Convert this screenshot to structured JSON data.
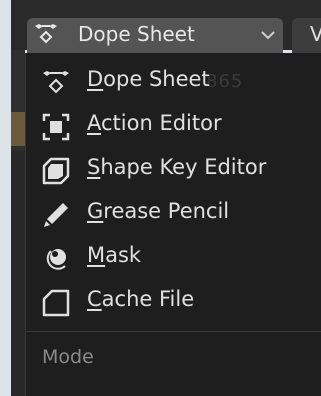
{
  "header": {
    "editor_type": {
      "label": "Dope Sheet",
      "icon": "dope-sheet-icon",
      "dropdown_icon": "chevron-down-icon"
    },
    "next_tab_initial": "V"
  },
  "background_ghost_text": "865",
  "menu": {
    "items": [
      {
        "accel": "D",
        "rest": "ope Sheet",
        "icon": "dope-sheet-icon"
      },
      {
        "accel": "A",
        "rest": "ction Editor",
        "icon": "action-editor-icon"
      },
      {
        "accel": "S",
        "rest": "hape Key Editor",
        "icon": "shape-key-icon"
      },
      {
        "accel": "G",
        "rest": "rease Pencil",
        "icon": "grease-pencil-icon"
      },
      {
        "accel": "M",
        "rest": "ask",
        "icon": "mask-icon"
      },
      {
        "accel": "C",
        "rest": "ache File",
        "icon": "cache-file-icon"
      }
    ],
    "section_label": "Mode"
  },
  "colors": {
    "menu_bg": "#1e1e1e",
    "header_select_bg": "#545454",
    "text": "#e0e0e0",
    "muted_text": "#8a8a8a"
  }
}
